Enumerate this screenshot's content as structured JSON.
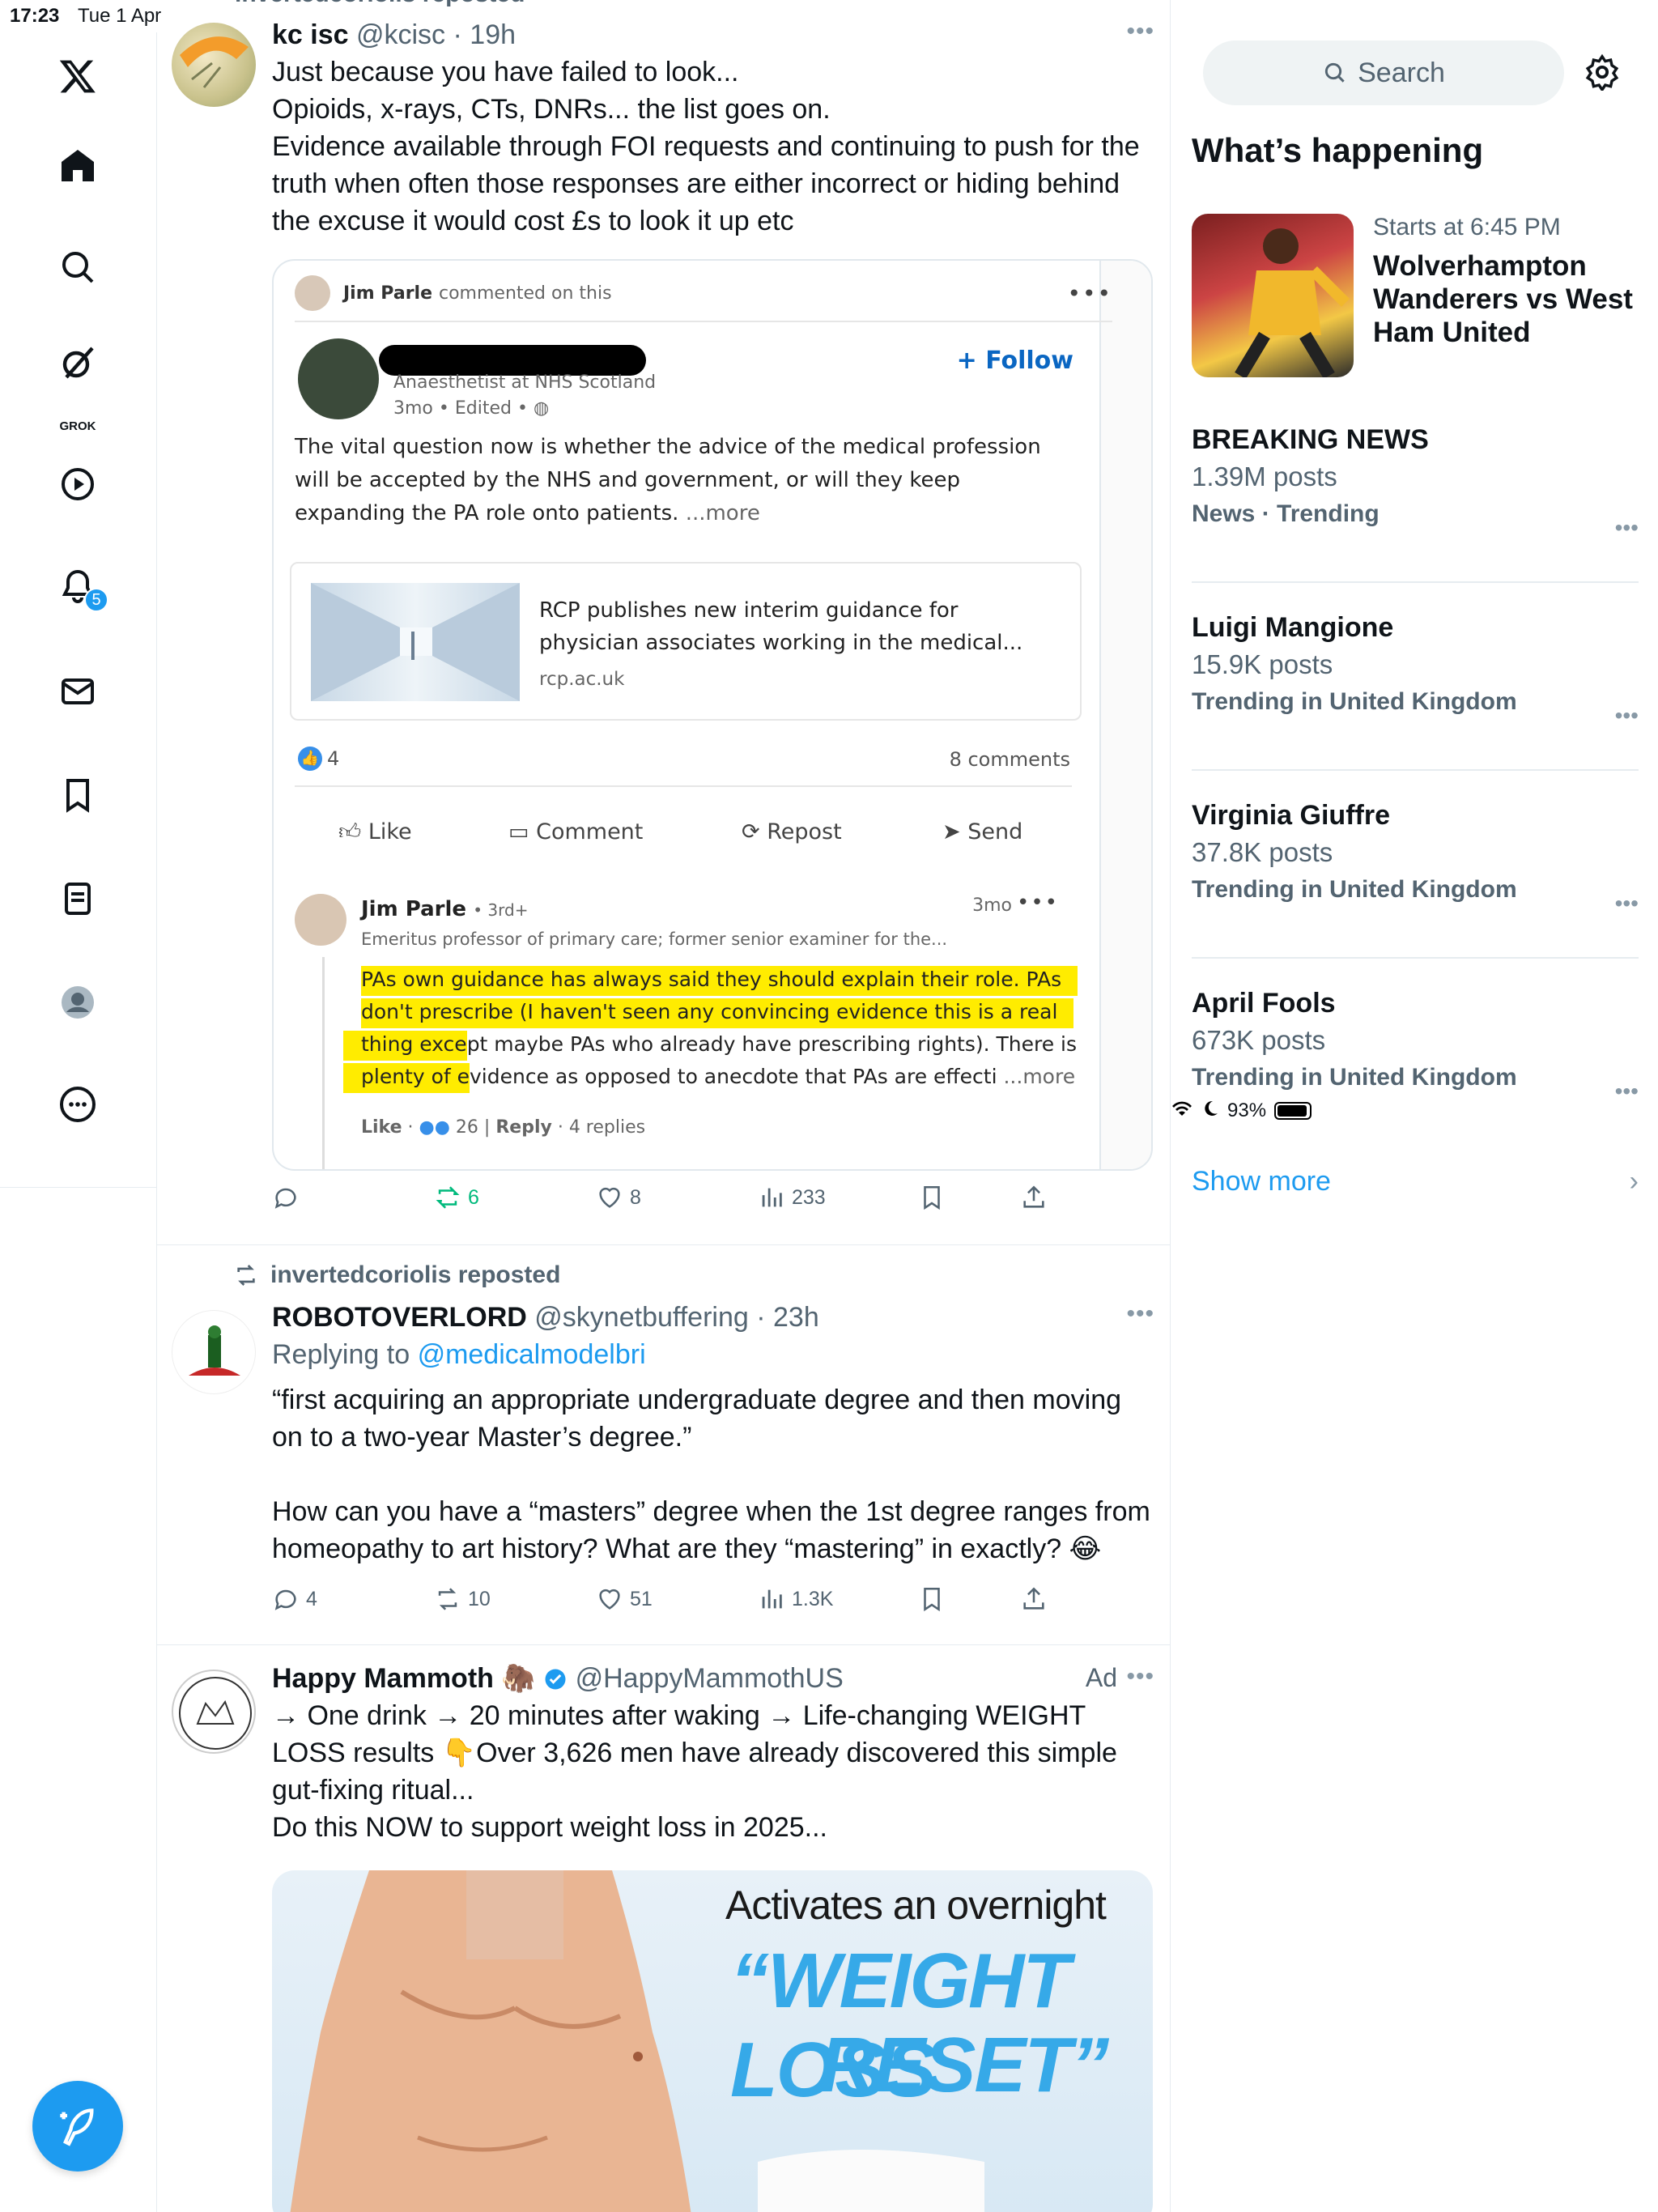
{
  "status": {
    "time": "17:23",
    "date": "Tue 1 Apr",
    "battery": "93%"
  },
  "nav": {
    "grok_label": "GROK",
    "notif_badge": "5"
  },
  "post1": {
    "reposted_header": "invertedcoriolis reposted",
    "name": "kc isc",
    "handle": "@kcisc",
    "time": "19h",
    "lines": [
      "Just because you have failed to look...",
      "Opioids, x-rays, CTs, DNRs... the list goes on.",
      "Evidence available through FOI requests and continuing to push for the",
      "truth when often those responses are either incorrect or hiding behind",
      "the excuse it would cost £s to look it up etc"
    ],
    "card": {
      "commenter": "Jim Parle",
      "commented_text": "commented on this",
      "author_role": "Anaesthetist at NHS Scotland",
      "author_meta": "3mo • Edited •",
      "follow": "+ Follow",
      "post_text": "The vital question now is whether the advice of the medical profession will be accepted by the NHS and government, or will they keep expanding the PA role onto patients.",
      "post_more": "...more",
      "link_title": "RCP publishes new interim guidance for physician associates working in the medical...",
      "link_domain": "rcp.ac.uk",
      "reactions": "4",
      "comments": "8 comments",
      "btn_like": "Like",
      "btn_comment": "Comment",
      "btn_repost": "Repost",
      "btn_send": "Send",
      "reply_name": "Jim Parle",
      "reply_degree": "• 3rd+",
      "reply_time": "3mo",
      "reply_headline": "Emeritus professor of primary care; former senior examiner for the...",
      "reply_line1": "PAs own guidance has always said they should explain their role. PAs",
      "reply_line2": "don't prescribe (I haven't seen any convincing evidence this is a real",
      "reply_line3a": "thing exce",
      "reply_line3b": "pt maybe PAs who already have prescribing rights). There is",
      "reply_line4a": "plenty of e",
      "reply_line4b": "vidence as opposed to anecdote that PAs are effecti",
      "reply_more": "...more",
      "reply_like": "Like",
      "reply_like_count": "26",
      "reply_reply": "Reply",
      "reply_replies": "4 replies"
    },
    "stats": {
      "reposts": "6",
      "likes": "8",
      "views": "233"
    }
  },
  "post2": {
    "reposted_header": "invertedcoriolis reposted",
    "name": "ROBOTOVERLORD",
    "handle": "@skynetbuffering",
    "time": "23h",
    "replying_prefix": "Replying to",
    "replying_to": "@medicalmodelbri",
    "lines": [
      "“first acquiring an appropriate undergraduate degree and then moving",
      "on to a two-year Master’s degree.”",
      "",
      "How can you have a “masters” degree when the 1st degree ranges from",
      "homeopathy to art history? What are they “mastering” in exactly? 😂"
    ],
    "stats": {
      "replies": "4",
      "reposts": "10",
      "likes": "51",
      "views": "1.3K"
    }
  },
  "post3": {
    "name": "Happy Mammoth 🦣",
    "handle": "@HappyMammothUS",
    "ad_label": "Ad",
    "lines": [
      "→ One drink → 20 minutes after waking → Life-changing WEIGHT",
      "LOSS results 👇Over 3,626 men have already discovered this simple",
      "gut-fixing ritual...",
      "Do this NOW to support weight loss in 2025..."
    ],
    "image_text1": "Activates an overnight",
    "image_text2": "“WEIGHT LOSS",
    "image_text3": "RESET”"
  },
  "sidebar": {
    "search_placeholder": "Search",
    "heading": "What’s happening",
    "event": {
      "meta": "Starts at 6:45 PM",
      "title": "Wolverhampton Wanderers vs West Ham United"
    },
    "trends": [
      {
        "title": "BREAKING NEWS",
        "posts": "1.39M posts",
        "meta": "News · Trending"
      },
      {
        "title": "Luigi Mangione",
        "posts": "15.9K posts",
        "meta": "Trending in United Kingdom"
      },
      {
        "title": "Virginia Giuffre",
        "posts": "37.8K posts",
        "meta": "Trending in United Kingdom"
      },
      {
        "title": "April Fools",
        "posts": "673K posts",
        "meta": "Trending in United Kingdom"
      }
    ],
    "show_more": "Show more"
  },
  "colors": {
    "accent": "#1d9bf0",
    "linkedin_blue": "#0a66c2",
    "highlight": "#ffec00",
    "repost_green": "#00ba7c"
  }
}
